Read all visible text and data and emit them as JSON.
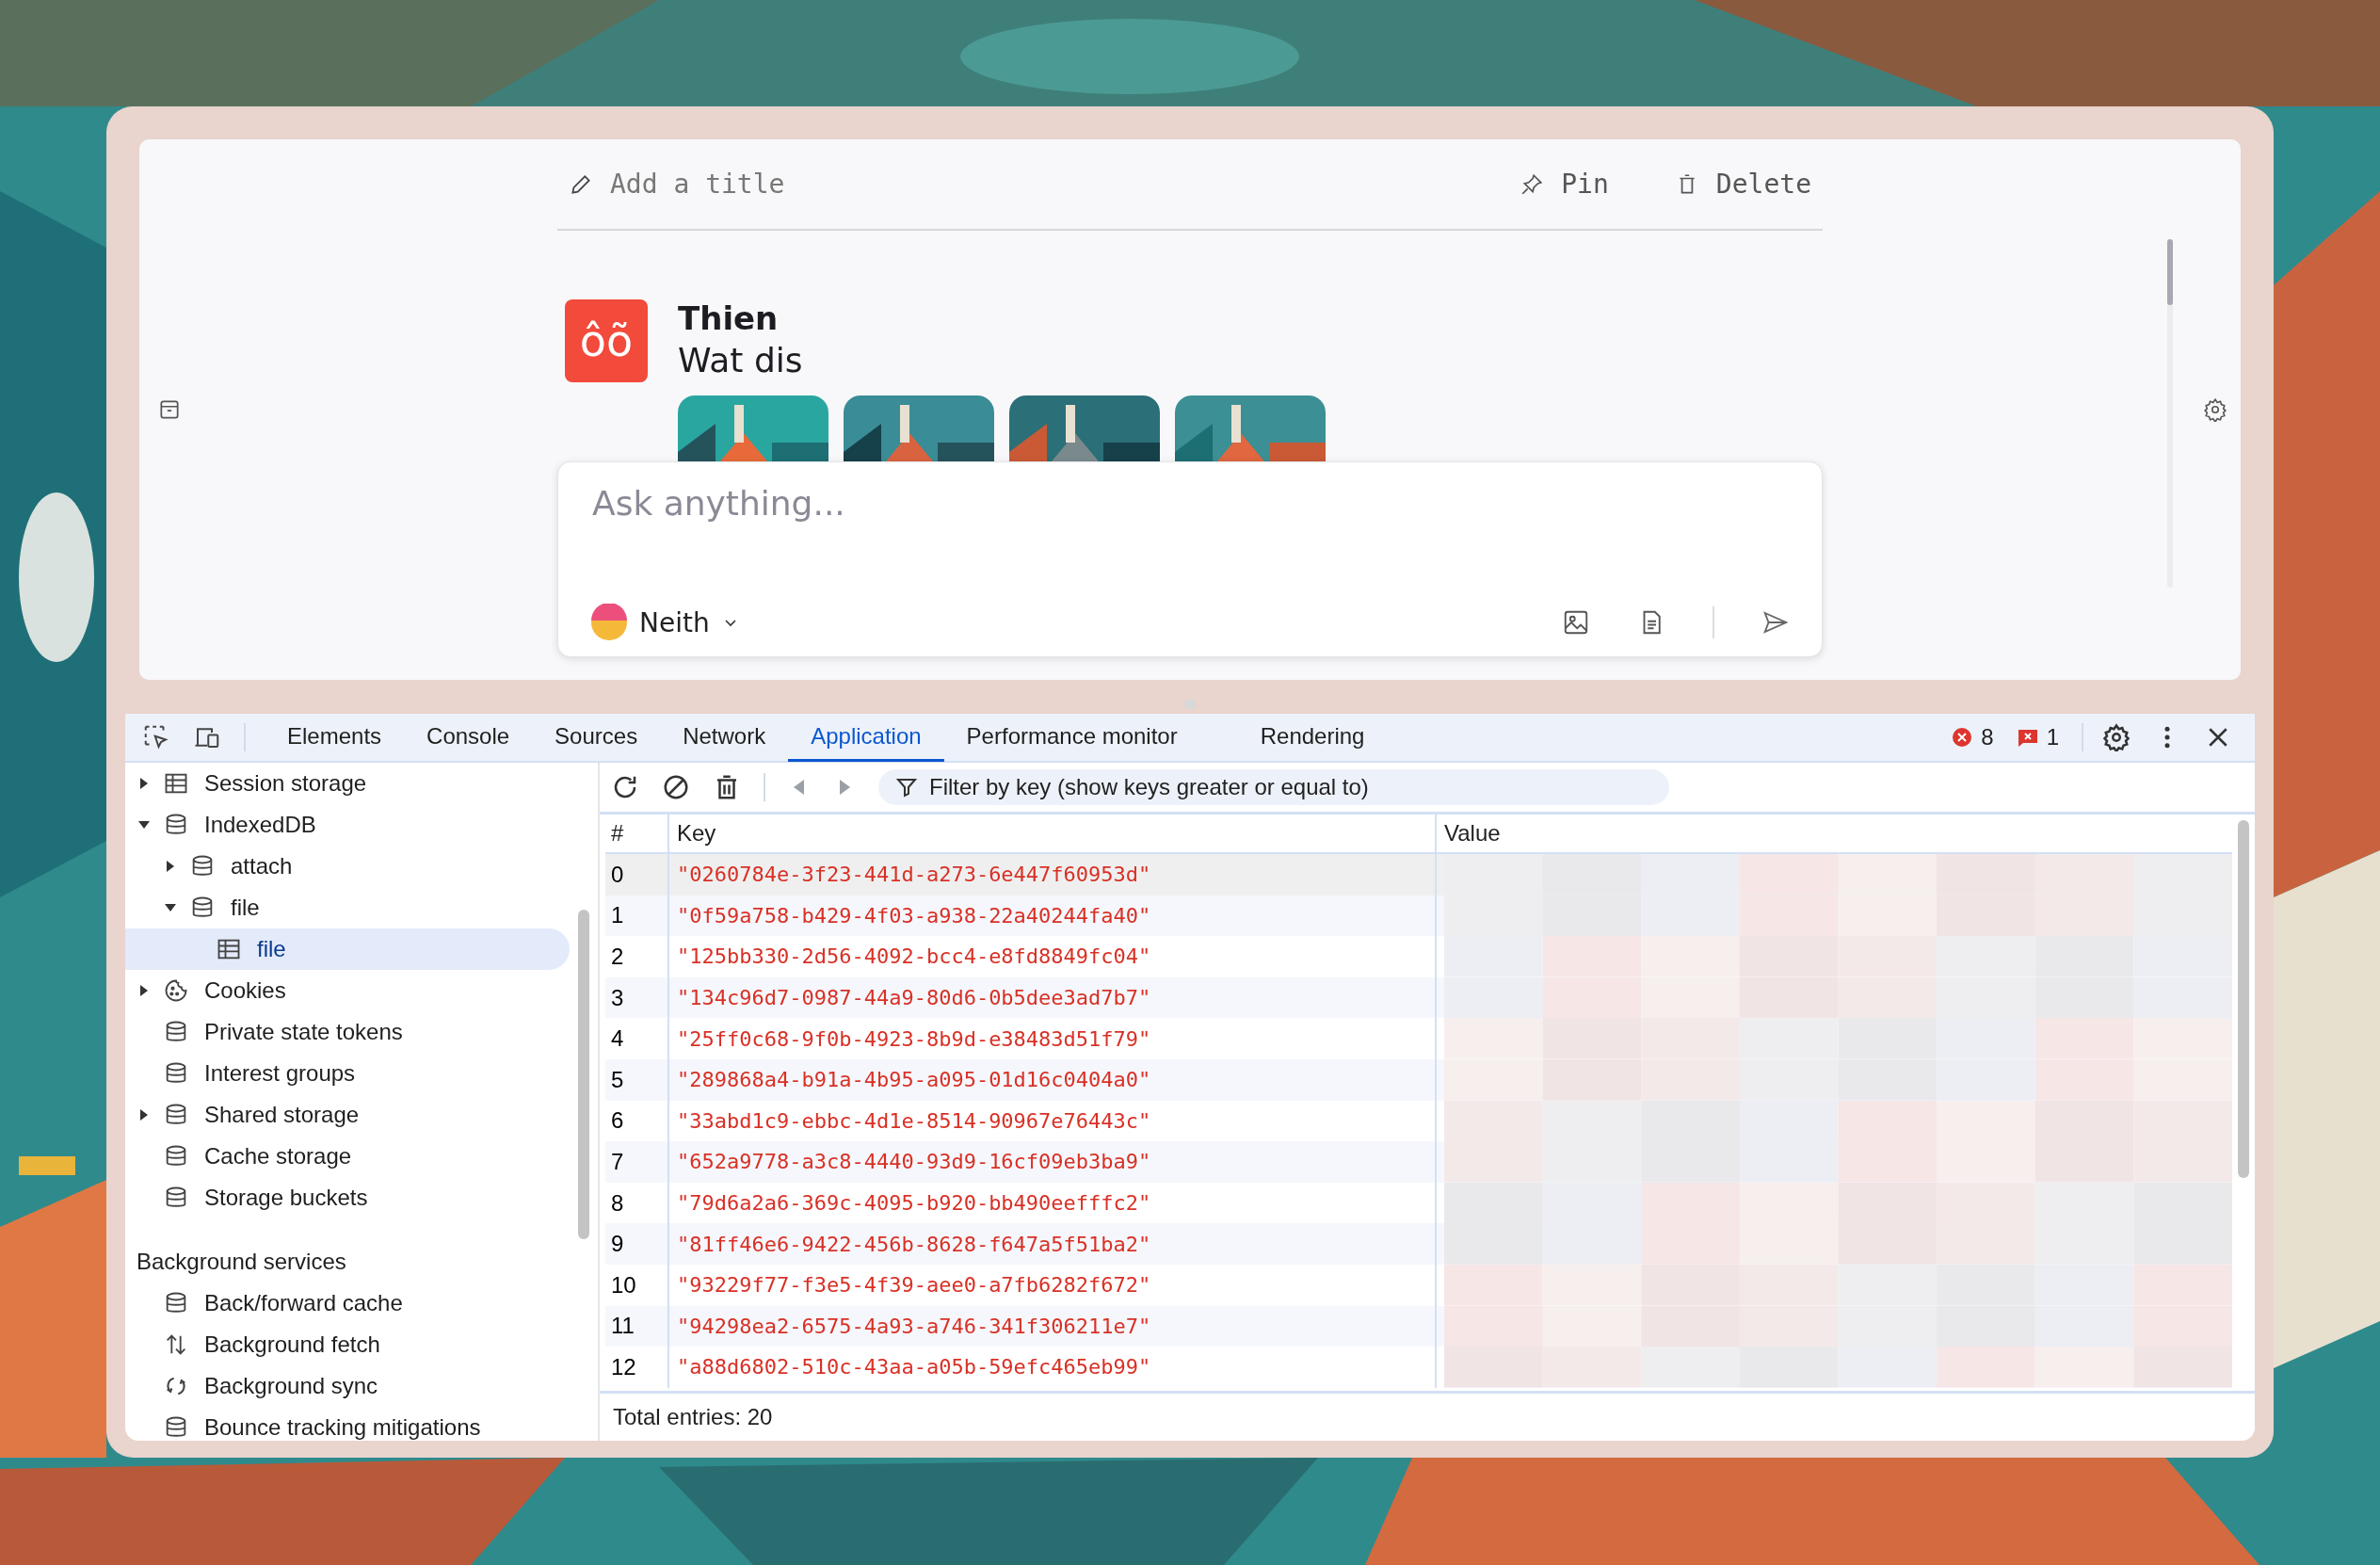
{
  "app": {
    "title_placeholder": "Add a title",
    "actions": [
      {
        "kind": "pin",
        "label": "Pin"
      },
      {
        "kind": "delete",
        "label": "Delete"
      }
    ],
    "message": {
      "avatar_text": "ôõ",
      "author": "Thien",
      "text": "Wat dis"
    },
    "composer": {
      "placeholder": "Ask anything...",
      "model": "Neith"
    }
  },
  "devtools": {
    "tabs": [
      {
        "label": "Elements",
        "selected": false
      },
      {
        "label": "Console",
        "selected": false
      },
      {
        "label": "Sources",
        "selected": false
      },
      {
        "label": "Network",
        "selected": false
      },
      {
        "label": "Application",
        "selected": true
      },
      {
        "label": "Performance monitor",
        "selected": false
      },
      {
        "label": "Rendering",
        "selected": false
      }
    ],
    "errors": "8",
    "issues": "1",
    "sidebar": {
      "items": [
        {
          "label": "Session storage",
          "kind": "table",
          "expanded": false,
          "selected": false
        },
        {
          "label": "IndexedDB",
          "kind": "database",
          "expanded": true,
          "selected": false,
          "children": [
            {
              "label": "attach",
              "kind": "database",
              "expanded": false,
              "selected": false
            },
            {
              "label": "file",
              "kind": "database",
              "expanded": true,
              "selected": false,
              "children": [
                {
                  "label": "file",
                  "kind": "table",
                  "selected": true
                }
              ]
            }
          ]
        },
        {
          "label": "Cookies",
          "kind": "cookie",
          "expanded": false,
          "selected": false
        },
        {
          "label": "Private state tokens",
          "kind": "database",
          "selected": false
        },
        {
          "label": "Interest groups",
          "kind": "database",
          "selected": false
        },
        {
          "label": "Shared storage",
          "kind": "database",
          "expanded": false,
          "selected": false
        },
        {
          "label": "Cache storage",
          "kind": "database",
          "selected": false
        },
        {
          "label": "Storage buckets",
          "kind": "database",
          "selected": false
        }
      ],
      "section": {
        "title": "Background services",
        "items": [
          {
            "label": "Back/forward cache",
            "kind": "database",
            "selected": false
          },
          {
            "label": "Background fetch",
            "kind": "fetch",
            "selected": false
          },
          {
            "label": "Background sync",
            "kind": "sync",
            "selected": false
          },
          {
            "label": "Bounce tracking mitigations",
            "kind": "database",
            "selected": false
          }
        ]
      }
    },
    "filter_placeholder": "Filter by key (show keys greater or equal to)",
    "table": {
      "columns": [
        "#",
        "Key",
        "Value"
      ],
      "rows": [
        {
          "index": "0",
          "key": "\"0260784e-3f23-441d-a273-6e447f60953d\"",
          "selected": true
        },
        {
          "index": "1",
          "key": "\"0f59a758-b429-4f03-a938-22a40244fa40\"",
          "selected": false
        },
        {
          "index": "2",
          "key": "\"125bb330-2d56-4092-bcc4-e8fd8849fc04\"",
          "selected": false
        },
        {
          "index": "3",
          "key": "\"134c96d7-0987-44a9-80d6-0b5dee3ad7b7\"",
          "selected": false
        },
        {
          "index": "4",
          "key": "\"25ff0c68-9f0b-4923-8b9d-e38483d51f79\"",
          "selected": false
        },
        {
          "index": "5",
          "key": "\"289868a4-b91a-4b95-a095-01d16c0404a0\"",
          "selected": false
        },
        {
          "index": "6",
          "key": "\"33abd1c9-ebbc-4d1e-8514-90967e76443c\"",
          "selected": false
        },
        {
          "index": "7",
          "key": "\"652a9778-a3c8-4440-93d9-16cf09eb3ba9\"",
          "selected": false
        },
        {
          "index": "8",
          "key": "\"79d6a2a6-369c-4095-b920-bb490eefffc2\"",
          "selected": false
        },
        {
          "index": "9",
          "key": "\"81ff46e6-9422-456b-8628-f647a5f51ba2\"",
          "selected": false
        },
        {
          "index": "10",
          "key": "\"93229f77-f3e5-4f39-aee0-a7fb6282f672\"",
          "selected": false
        },
        {
          "index": "11",
          "key": "\"94298ea2-6575-4a93-a746-341f306211e7\"",
          "selected": false
        },
        {
          "index": "12",
          "key": "\"a88d6802-510c-43aa-a05b-59efc465eb99\"",
          "selected": false
        }
      ]
    },
    "footer": "Total entries: 20"
  }
}
